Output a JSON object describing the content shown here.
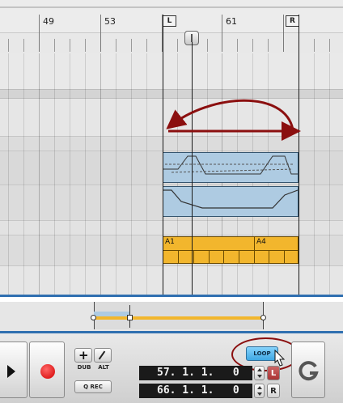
{
  "ruler": {
    "bar_numbers": [
      "49",
      "53",
      "61"
    ],
    "left_locator": "L",
    "right_locator": "R"
  },
  "lanes": {
    "pattern_labels": [
      "A1",
      "A4"
    ]
  },
  "transport": {
    "dub_label": "DUB",
    "alt_label": "ALT",
    "qrec_label": "Q REC",
    "loop_label": "LOOP",
    "left_locator_value": "57. 1. 1.   0",
    "right_locator_value": "66. 1. 1.   0",
    "left_locator_tag": "L",
    "right_locator_tag": "R"
  },
  "colors": {
    "clip_blue": "#aecbe2",
    "clip_yellow": "#f2b62d",
    "loop_active": "#59b6ec",
    "annotation_red": "#8b0f0f",
    "overview_border": "#2f6fb0"
  },
  "icons": {
    "play": "play-icon",
    "record": "record-icon",
    "add": "plus-icon",
    "edit": "pencil-icon",
    "spin_up": "chevron-up-icon",
    "spin_down": "chevron-down-icon",
    "reset": "refresh-icon",
    "cursor": "pointer-cursor-icon"
  }
}
